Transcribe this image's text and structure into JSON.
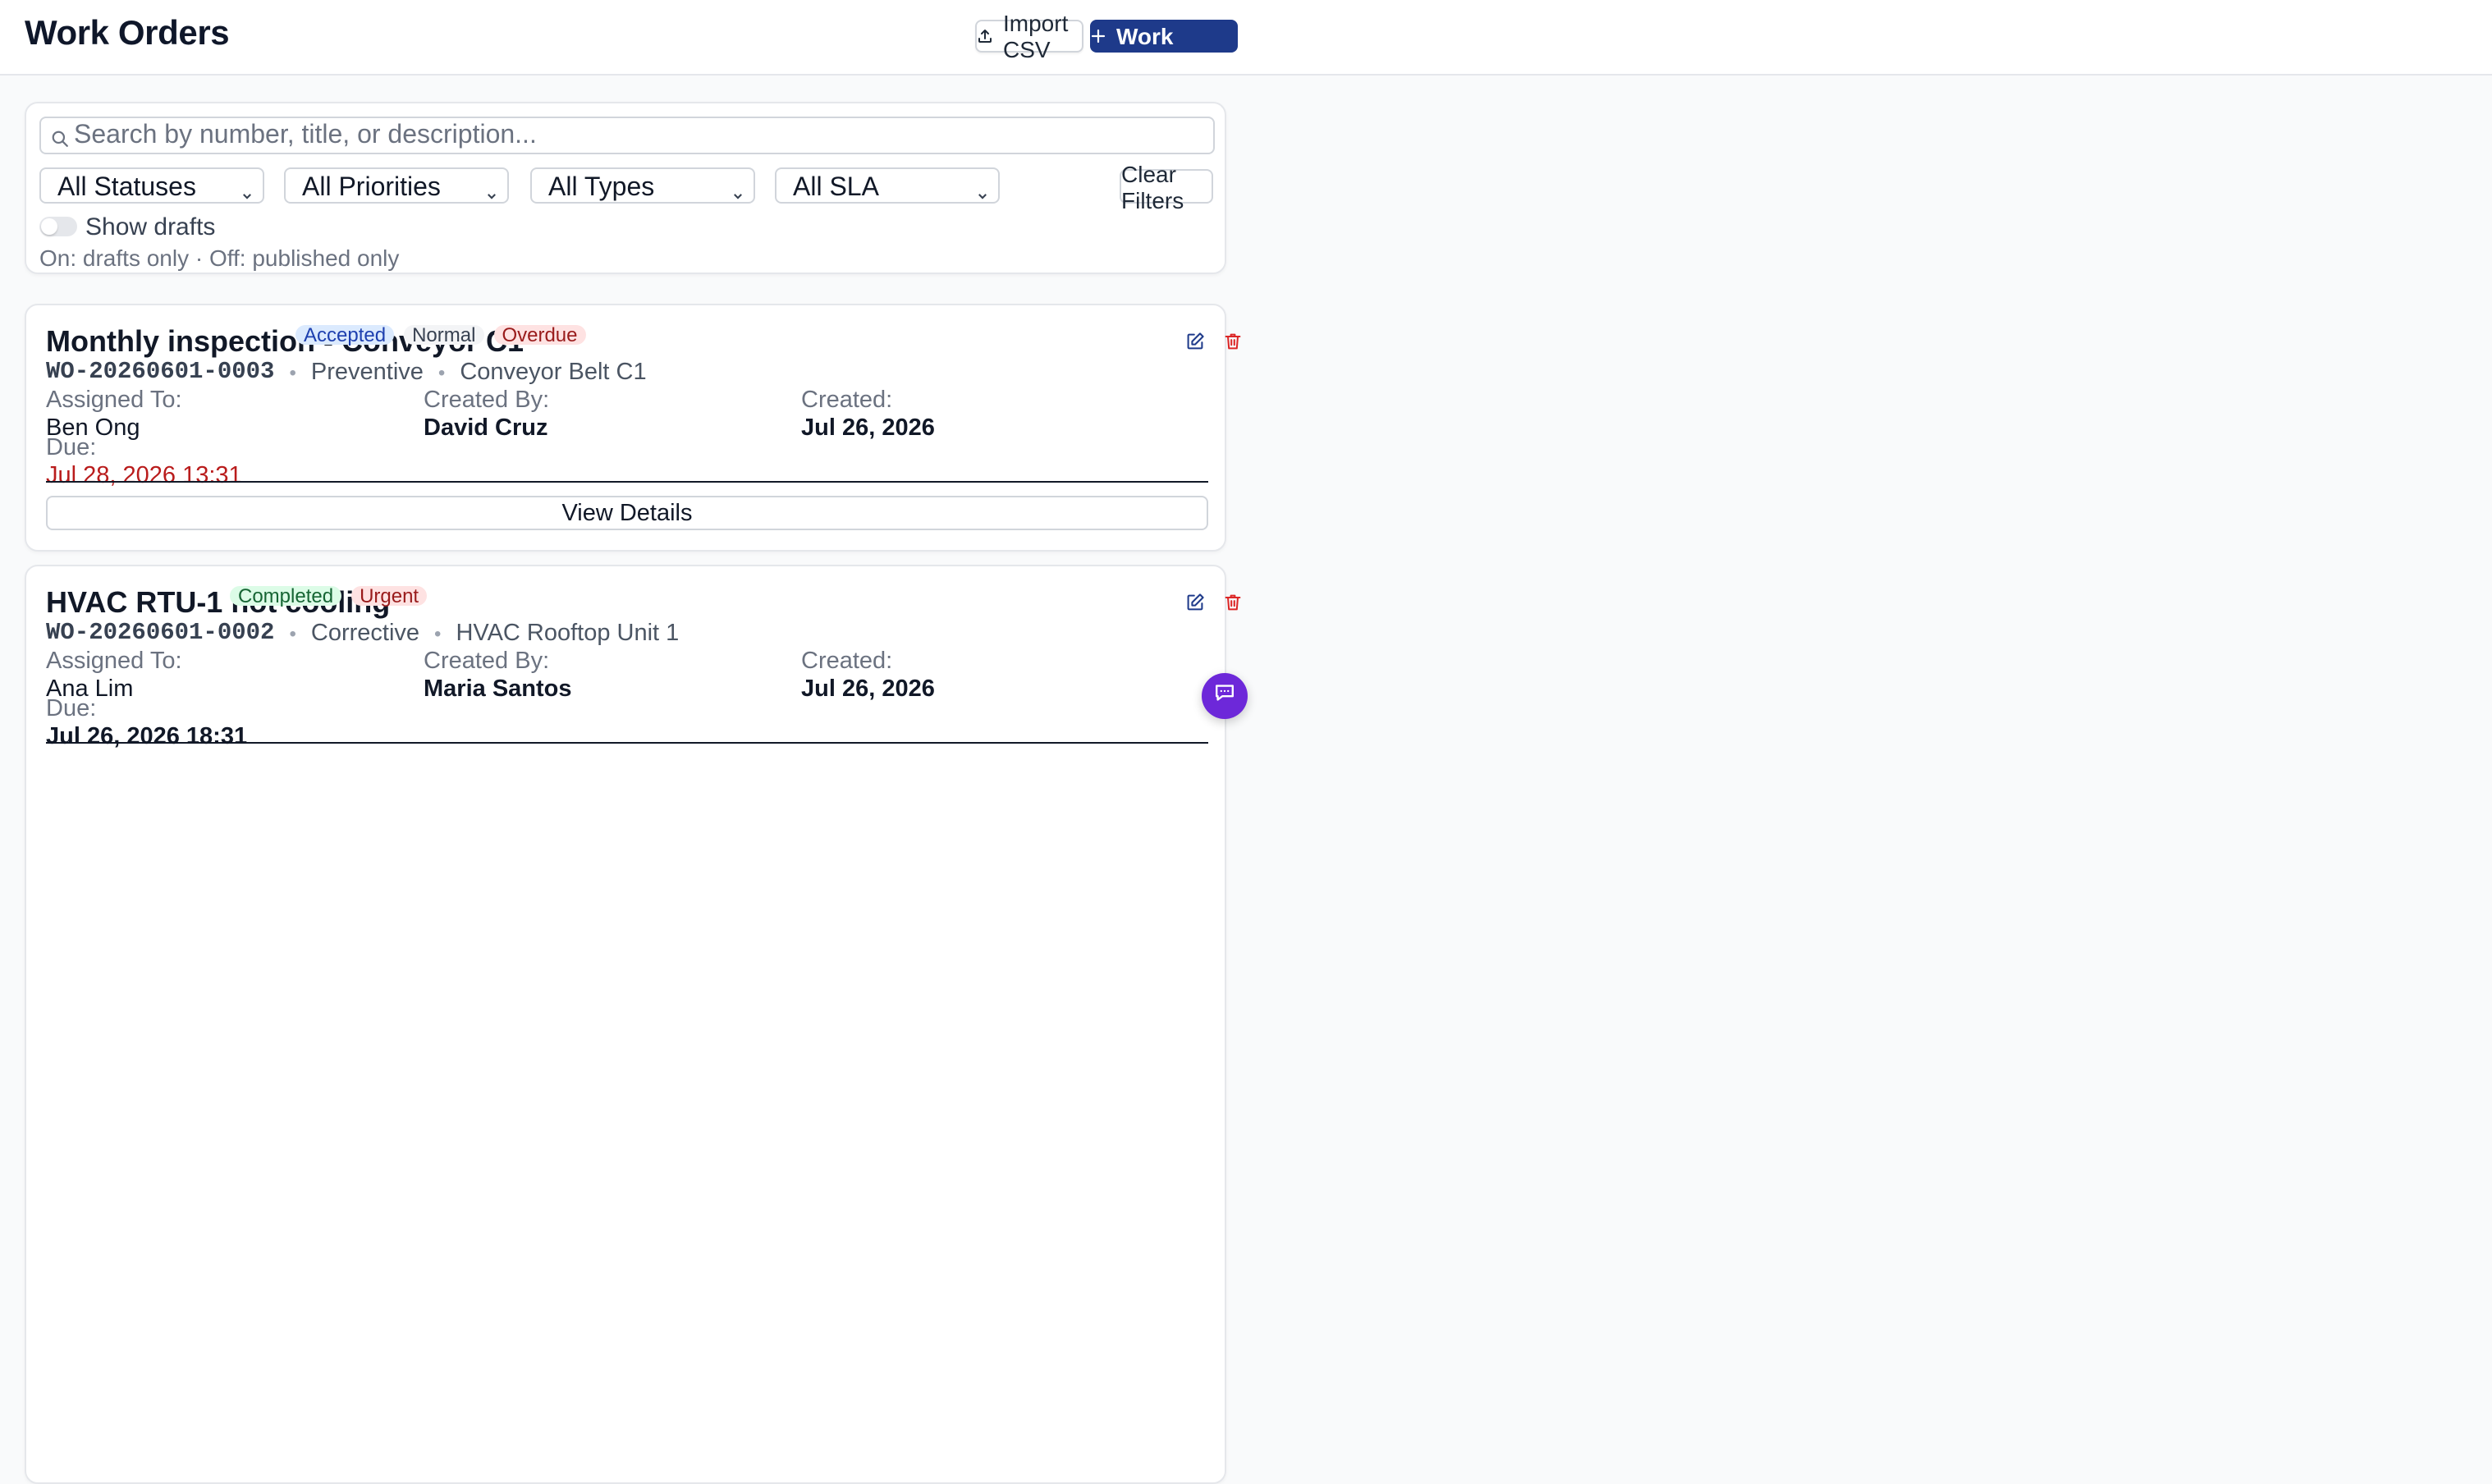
{
  "header": {
    "title": "Work Orders",
    "import_label": "Import CSV",
    "create_label": "Create Work Order"
  },
  "filters": {
    "search_placeholder": "Search by number, title, or description...",
    "status": "All Statuses",
    "priority": "All Priorities",
    "type": "All Types",
    "sla": "All SLA",
    "clear_label": "Clear Filters",
    "drafts_label": "Show drafts",
    "drafts_on": false,
    "hint": "On: drafts only · Off: published only"
  },
  "labels": {
    "assigned_to": "Assigned To:",
    "created_by": "Created By:",
    "created": "Created:",
    "due": "Due:",
    "view_details": "View Details"
  },
  "work_orders": [
    {
      "title": "Monthly inspection - Conveyor C1",
      "badges": [
        "Accepted",
        "Normal",
        "Overdue"
      ],
      "number": "WO-20260601-0003",
      "type": "Preventive",
      "asset": "Conveyor Belt C1",
      "assigned_to": "Ben Ong",
      "created_by": "David Cruz",
      "created": "Jul 26, 2026",
      "due": "Jul 28, 2026 13:31"
    },
    {
      "title": "HVAC RTU-1 not cooling",
      "badges": [
        "Completed",
        "Urgent"
      ],
      "number": "WO-20260601-0002",
      "type": "Corrective",
      "asset": "HVAC Rooftop Unit 1",
      "assigned_to": "Ana Lim",
      "created_by": "Maria Santos",
      "created": "Jul 26, 2026",
      "due": "Jul 26, 2026 18:31"
    }
  ],
  "colors": {
    "primary": "#1e3a8a",
    "overdue_text": "#b91c1c",
    "chat_fab": "#6d28d9"
  },
  "icons": {
    "import": "upload-icon",
    "create": "plus-icon",
    "search": "search-icon",
    "edit": "edit-icon",
    "delete": "trash-icon",
    "chat": "chat-icon"
  }
}
